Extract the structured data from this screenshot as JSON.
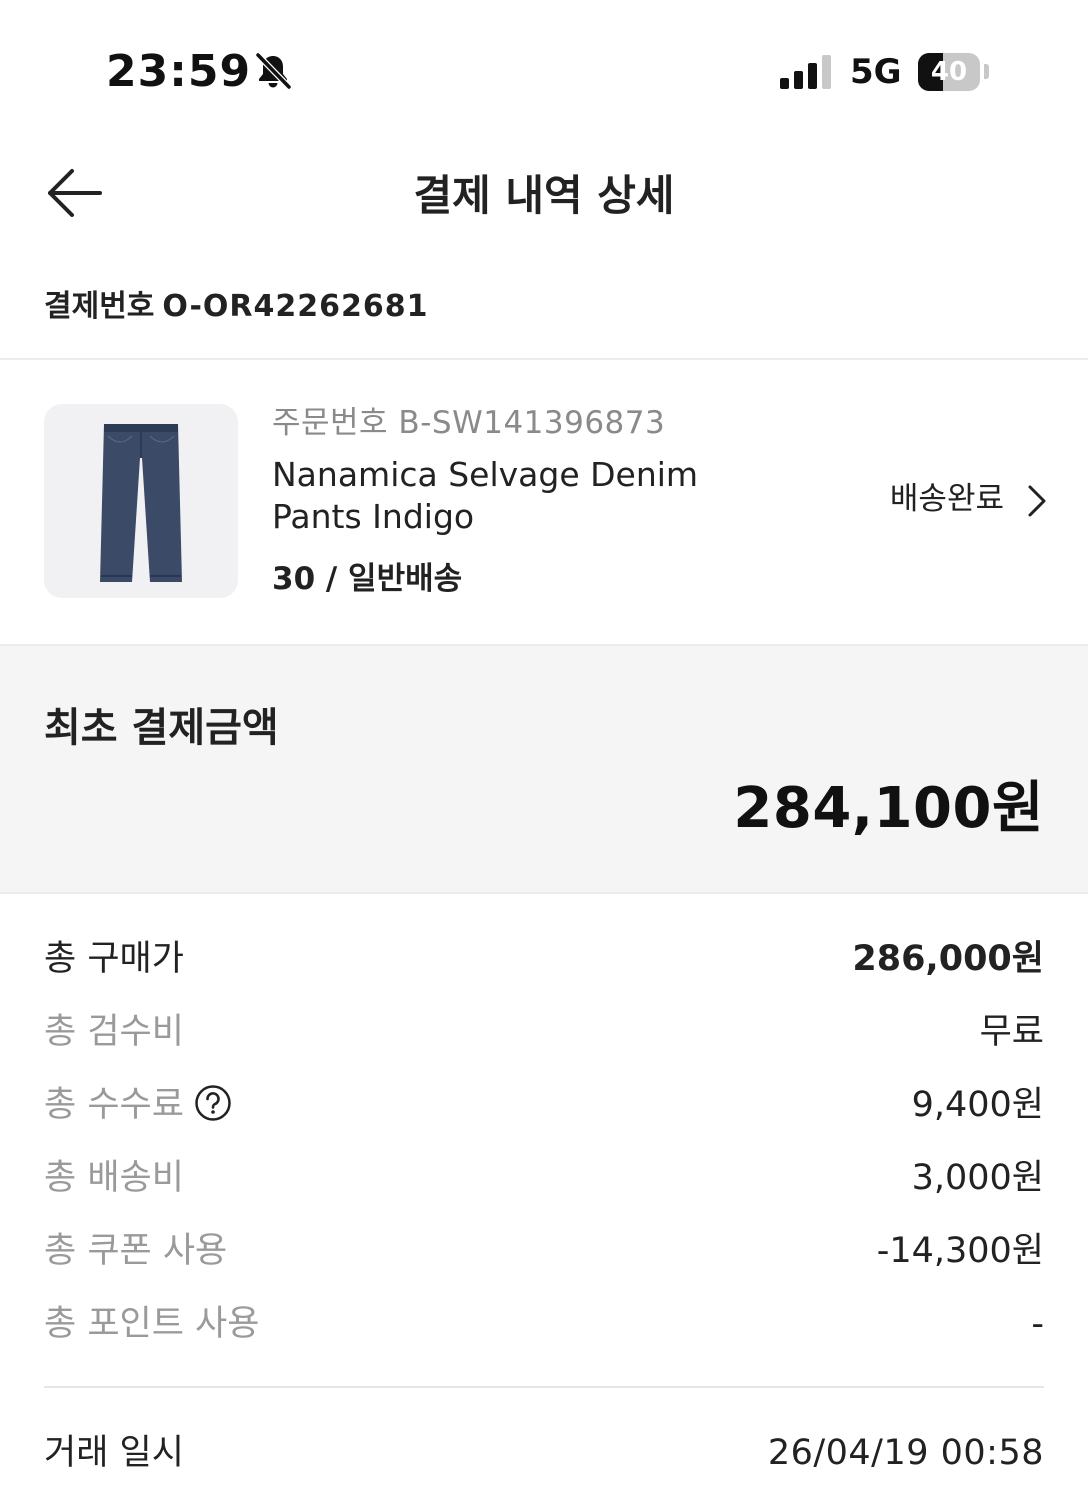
{
  "status_bar": {
    "time": "23:59",
    "network": "5G",
    "battery": "40",
    "battery_level": 0.4
  },
  "header": {
    "title": "결제 내역 상세",
    "back_icon": "back-arrow-icon"
  },
  "payment": {
    "number_label": "결제번호",
    "number_value": "O-OR42262681"
  },
  "product": {
    "order_number": "주문번호 B-SW141396873",
    "name": "Nanamica Selvage Denim Pants Indigo",
    "option": "30 / 일반배송",
    "delivery_status": "배송완료",
    "image_icon": "denim-pants-image"
  },
  "initial_payment": {
    "label": "최초 결제금액",
    "amount": "284,100원"
  },
  "breakdown": [
    {
      "label": "총 구매가",
      "value": "286,000원"
    },
    {
      "label": "총 검수비",
      "value": "무료"
    },
    {
      "label": "총 수수료",
      "value": "9,400원"
    },
    {
      "label": "총 배송비",
      "value": "3,000원"
    },
    {
      "label": "총 쿠폰 사용",
      "value": "-14,300원"
    },
    {
      "label": "총 포인트 사용",
      "value": "-"
    }
  ],
  "transaction": {
    "label": "거래 일시",
    "value": "26/04/19 00:58"
  },
  "colors": {
    "text_primary": "#222222",
    "text_secondary": "#9a9a9a",
    "section_bg": "#f5f5f6",
    "thumb_bg": "#f1f1f3",
    "denim": "#3b4a66"
  }
}
